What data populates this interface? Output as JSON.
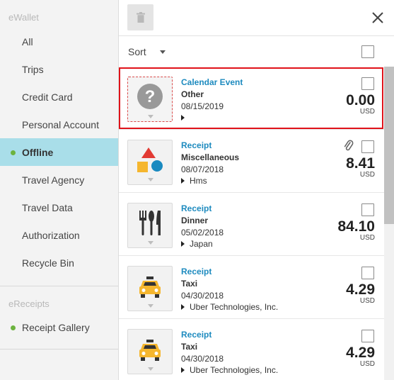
{
  "sidebar": {
    "section_ewallet": "eWallet",
    "section_ereceipts": "eReceipts",
    "items": [
      {
        "label": "All"
      },
      {
        "label": "Trips"
      },
      {
        "label": "Credit Card"
      },
      {
        "label": "Personal Account"
      },
      {
        "label": "Offline"
      },
      {
        "label": "Travel Agency"
      },
      {
        "label": "Travel Data"
      },
      {
        "label": "Authorization"
      },
      {
        "label": "Recycle Bin"
      }
    ],
    "receipt_gallery": "Receipt Gallery",
    "active_item": "Offline",
    "dot_color": "#6cb33f"
  },
  "toolbar": {
    "trash_icon": "trash-icon",
    "close_icon": "close-icon"
  },
  "sort": {
    "label": "Sort"
  },
  "rows": [
    {
      "type": "Calendar Event",
      "category": "Other",
      "date": "08/15/2019",
      "vendor": "",
      "amount": "0.00",
      "currency": "USD",
      "icon": "question-icon",
      "has_attachment": false
    },
    {
      "type": "Receipt",
      "category": "Miscellaneous",
      "date": "08/07/2018",
      "vendor": "Hms",
      "amount": "8.41",
      "currency": "USD",
      "icon": "shapes-icon",
      "has_attachment": true
    },
    {
      "type": "Receipt",
      "category": "Dinner",
      "date": "05/02/2018",
      "vendor": "Japan",
      "amount": "84.10",
      "currency": "USD",
      "icon": "utensils-icon",
      "has_attachment": false
    },
    {
      "type": "Receipt",
      "category": "Taxi",
      "date": "04/30/2018",
      "vendor": "Uber Technologies, Inc.",
      "amount": "4.29",
      "currency": "USD",
      "icon": "taxi-icon",
      "has_attachment": false
    },
    {
      "type": "Receipt",
      "category": "Taxi",
      "date": "04/30/2018",
      "vendor": "Uber Technologies, Inc.",
      "amount": "4.29",
      "currency": "USD",
      "icon": "taxi-icon",
      "has_attachment": false
    }
  ],
  "colors": {
    "accent": "#1e8bbf",
    "active_bg": "#a9dee9",
    "highlight": "#e0131a"
  }
}
